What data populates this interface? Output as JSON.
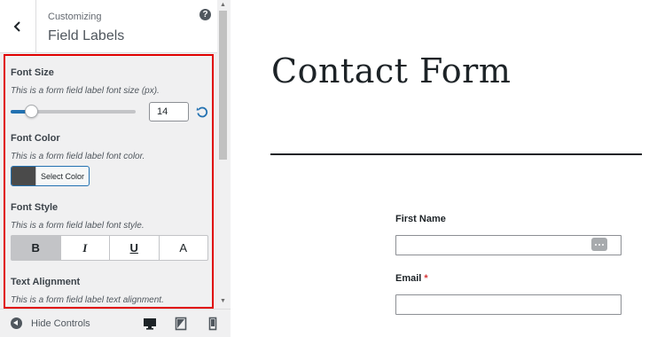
{
  "sidebar": {
    "subtitle": "Customizing",
    "title": "Field Labels",
    "help_glyph": "?",
    "sections": {
      "font_size": {
        "label": "Font Size",
        "description": "This is a form field label font size (px).",
        "value": "14",
        "slider_fraction": 0.17
      },
      "font_color": {
        "label": "Font Color",
        "description": "This is a form field label font color.",
        "button_label": "Select Color",
        "swatch_color": "#4a4a4a"
      },
      "font_style": {
        "label": "Font Style",
        "description": "This is a form field label font style.",
        "buttons": [
          "B",
          "I",
          "U",
          "A"
        ],
        "active": "B"
      },
      "text_alignment": {
        "label": "Text Alignment",
        "description": "This is a form field label text alignment."
      }
    },
    "footer": {
      "hide_controls": "Hide Controls"
    }
  },
  "preview": {
    "page_title": "Contact Form",
    "fields": [
      {
        "label": "First Name",
        "required": false
      },
      {
        "label": "Email",
        "required": true,
        "required_mark": "*"
      }
    ]
  },
  "colors": {
    "accent": "#2271b1",
    "highlight_border": "#e00000",
    "required": "#d63638"
  }
}
